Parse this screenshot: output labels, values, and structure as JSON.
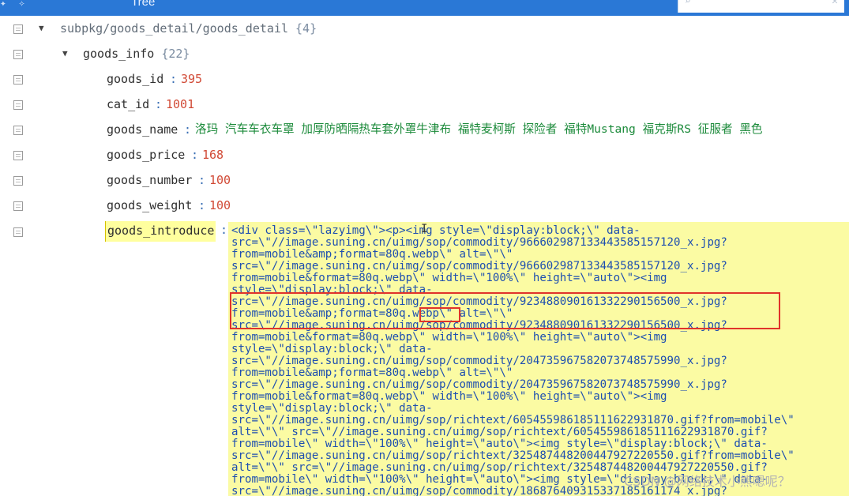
{
  "topbar": {
    "tab_label": "Tree"
  },
  "tree": {
    "root": {
      "path": "subpkg/goods_detail/goods_detail",
      "count": "{4}"
    },
    "goods_info": {
      "key": "goods_info",
      "count": "{22}"
    },
    "fields": [
      {
        "key": "goods_id",
        "value": "395",
        "type": "number"
      },
      {
        "key": "cat_id",
        "value": "1001",
        "type": "number"
      },
      {
        "key": "goods_name",
        "value": "洛玛 汽车车衣车罩 加厚防晒隔热车套外罩牛津布 福特麦柯斯 探险者 福特Mustang 福克斯RS 征服者 黑色",
        "type": "string"
      },
      {
        "key": "goods_price",
        "value": "168",
        "type": "number"
      },
      {
        "key": "goods_number",
        "value": "100",
        "type": "number"
      },
      {
        "key": "goods_weight",
        "value": "100",
        "type": "number"
      }
    ],
    "goods_introduce": {
      "key": "goods_introduce",
      "value_lines": [
        "<div class=\\\"lazyimg\\\"><p><img style=\\\"display:block;\\\" data-",
        "src=\\\"//image.suning.cn/uimg/sop/commodity/966602987133443585157120_x.jpg?",
        "from=mobile&amp;format=80q.webp\\\" alt=\\\"\\\"",
        "src=\\\"//image.suning.cn/uimg/sop/commodity/966602987133443585157120_x.jpg?",
        "from=mobile&format=80q.webp\\\" width=\\\"100%\\\" height=\\\"auto\\\"><img",
        "style=\\\"display:block;\\\" data-",
        "src=\\\"//image.suning.cn/uimg/sop/commodity/923488090161332290156500_x.jpg?",
        "from=mobile&amp;format=80q.webp\\\" alt=\\\"\\\"",
        "src=\\\"//image.suning.cn/uimg/sop/commodity/923488090161332290156500_x.jpg?",
        "from=mobile&format=80q.webp\\\" width=\\\"100%\\\" height=\\\"auto\\\"><img",
        "style=\\\"display:block;\\\" data-",
        "src=\\\"//image.suning.cn/uimg/sop/commodity/204735967582073748575990_x.jpg?",
        "from=mobile&amp;format=80q.webp\\\" alt=\\\"\\\"",
        "src=\\\"//image.suning.cn/uimg/sop/commodity/204735967582073748575990_x.jpg?",
        "from=mobile&format=80q.webp\\\" width=\\\"100%\\\" height=\\\"auto\\\"><img",
        "style=\\\"display:block;\\\" data-",
        "src=\\\"//image.suning.cn/uimg/sop/richtext/605455986185111622931870.gif?from=mobile\\\"",
        "alt=\\\"\\\" src=\\\"//image.suning.cn/uimg/sop/richtext/605455986185111622931870.gif?",
        "from=mobile\\\" width=\\\"100%\\\" height=\\\"auto\\\"><img style=\\\"display:block;\\\" data-",
        "src=\\\"//image.suning.cn/uimg/sop/richtext/325487448200447927220550.gif?from=mobile\\\"",
        "alt=\\\"\\\" src=\\\"//image.suning.cn/uimg/sop/richtext/325487448200447927220550.gif?",
        "from=mobile\\\" width=\\\"100%\\\" height=\\\"auto\\\"><img style=\\\"display:block;\\\" data-",
        "src=\\\"//image.suning.cn/uimg/sop/commodity/186876409315337185161174_x.jpg?"
      ]
    }
  },
  "watermark": "CSDN @网络技术小熊嗯呢？"
}
